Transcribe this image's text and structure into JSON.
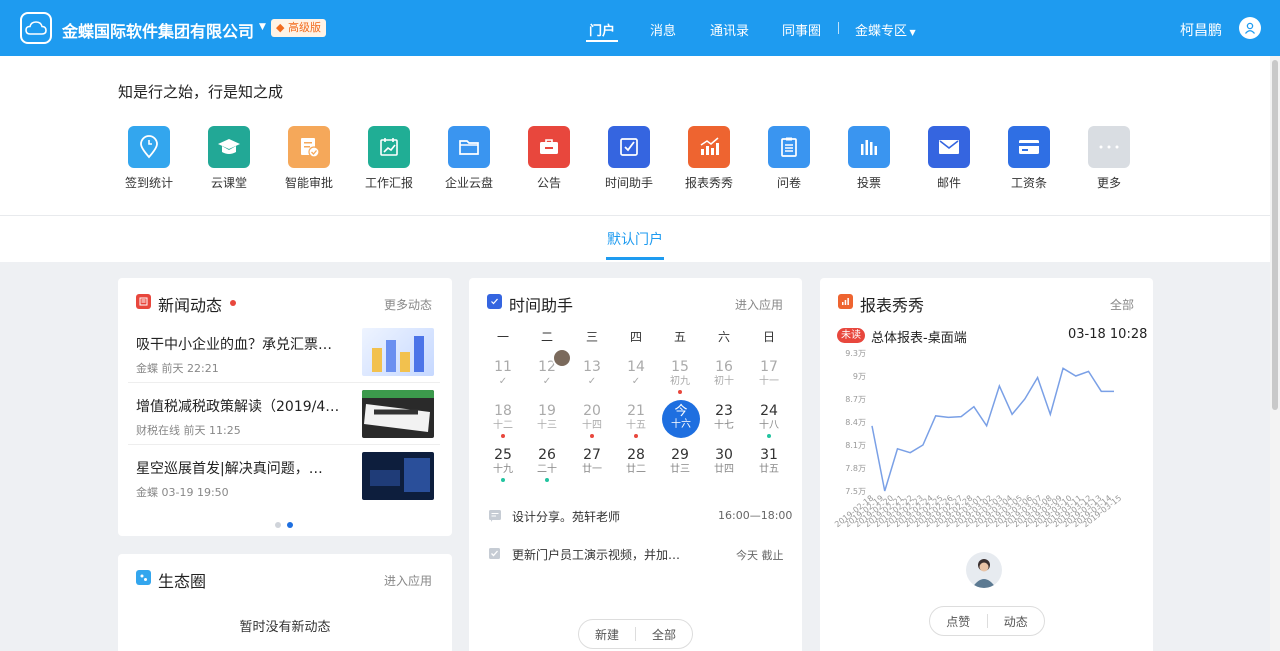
{
  "topbar": {
    "company": "金蝶国际软件集团有限公司",
    "badge": "高级版",
    "nav": [
      "门户",
      "消息",
      "通讯录",
      "同事圈",
      "金蝶专区"
    ],
    "user": "柯昌鹏"
  },
  "motto": "知是行之始，行是知之成",
  "apps": [
    {
      "label": "签到统计",
      "icon": "location-pin-icon",
      "color": "#33a6ee"
    },
    {
      "label": "云课堂",
      "icon": "graduation-cap-icon",
      "color": "#22a896"
    },
    {
      "label": "智能审批",
      "icon": "approval-icon",
      "color": "#f5a85a"
    },
    {
      "label": "工作汇报",
      "icon": "report-chart-icon",
      "color": "#20ae95"
    },
    {
      "label": "企业云盘",
      "icon": "folder-icon",
      "color": "#3a95f0"
    },
    {
      "label": "公告",
      "icon": "announcement-icon",
      "color": "#e8473d"
    },
    {
      "label": "时间助手",
      "icon": "checkbox-icon",
      "color": "#3565e0"
    },
    {
      "label": "报表秀秀",
      "icon": "bar-trend-icon",
      "color": "#ee6430"
    },
    {
      "label": "问卷",
      "icon": "clipboard-icon",
      "color": "#3a95f0"
    },
    {
      "label": "投票",
      "icon": "bars-icon",
      "color": "#3a95f0"
    },
    {
      "label": "邮件",
      "icon": "mail-icon",
      "color": "#3565e0"
    },
    {
      "label": "工资条",
      "icon": "card-icon",
      "color": "#2f6fe4"
    },
    {
      "label": "更多",
      "icon": "more-icon",
      "color": "#d9dde2"
    }
  ],
  "portal_tab": "默认门户",
  "news": {
    "title": "新闻动态",
    "more": "更多动态",
    "items": [
      {
        "title": "吸干中小企业的血？承兑汇票…",
        "meta": "金蝶 前天 22:21"
      },
      {
        "title": "增值税减税政策解读（2019/4…",
        "meta": "财税在线 前天 11:25"
      },
      {
        "title": "星空巡展首发|解决真问题，…",
        "meta": "金蝶 03-19 19:50"
      }
    ]
  },
  "eco": {
    "title": "生态圈",
    "link": "进入应用",
    "empty": "暂时没有新动态"
  },
  "time": {
    "title": "时间助手",
    "link": "进入应用",
    "weekdays": [
      "一",
      "二",
      "三",
      "四",
      "五",
      "六",
      "日"
    ],
    "rows": [
      [
        {
          "d": "11",
          "s": "✓",
          "past": true
        },
        {
          "d": "12",
          "s": "✓",
          "past": true
        },
        {
          "d": "13",
          "s": "✓",
          "past": true
        },
        {
          "d": "14",
          "s": "✓",
          "past": true
        },
        {
          "d": "15",
          "s": "初九",
          "past": true,
          "dot": "#e8473d"
        },
        {
          "d": "16",
          "s": "初十",
          "past": true
        },
        {
          "d": "17",
          "s": "十一",
          "past": true
        }
      ],
      [
        {
          "d": "18",
          "s": "十二",
          "past": true,
          "dot": "#e8473d"
        },
        {
          "d": "19",
          "s": "十三",
          "past": true
        },
        {
          "d": "20",
          "s": "十四",
          "past": true,
          "dot": "#e8473d"
        },
        {
          "d": "21",
          "s": "十五",
          "past": true,
          "dot": "#e8473d"
        },
        {
          "d": "今",
          "s": "十六",
          "today": true
        },
        {
          "d": "23",
          "s": "十七"
        },
        {
          "d": "24",
          "s": "十八",
          "dot": "#22c4a0"
        }
      ],
      [
        {
          "d": "25",
          "s": "十九",
          "dot": "#22c4a0"
        },
        {
          "d": "26",
          "s": "二十",
          "dot": "#22c4a0"
        },
        {
          "d": "27",
          "s": "廿一"
        },
        {
          "d": "28",
          "s": "廿二"
        },
        {
          "d": "29",
          "s": "廿三"
        },
        {
          "d": "30",
          "s": "廿四"
        },
        {
          "d": "31",
          "s": "廿五"
        }
      ]
    ],
    "tasks": [
      {
        "text": "设计分享。苑轩老师",
        "time": "16:00—18:00"
      },
      {
        "text": "更新门户员工演示视频，并加…",
        "time": "今天 截止"
      }
    ],
    "btn_new": "新建",
    "btn_all": "全部"
  },
  "report": {
    "title": "报表秀秀",
    "link": "全部",
    "tag": "未读",
    "name": "总体报表-桌面端",
    "datetime": "03-18 10:28",
    "btn_like": "点赞",
    "btn_feed": "动态",
    "chart_data": {
      "type": "line",
      "yticks": [
        "9.3万",
        "9万",
        "8.7万",
        "8.4万",
        "8.1万",
        "7.8万",
        "7.5万"
      ],
      "ylim": [
        74000,
        93000
      ],
      "x": [
        "2019-02-18",
        "2019-02-19",
        "2019-02-20",
        "2019-02-21",
        "2019-02-22",
        "2019-02-23",
        "2019-02-24",
        "2019-02-25",
        "2019-02-26",
        "2019-02-27",
        "2019-02-28",
        "2019-03-01",
        "2019-03-02",
        "2019-03-03",
        "2019-03-04",
        "2019-03-05",
        "2019-03-06",
        "2019-03-07",
        "2019-03-08",
        "2019-03-09",
        "2019-03-10",
        "2019-03-11",
        "2019-03-12",
        "2019-03-13",
        "2019-03-14",
        "2019-03-15"
      ],
      "values": [
        83500,
        75000,
        80500,
        80000,
        81000,
        84800,
        84600,
        84700,
        86000,
        83500,
        88700,
        85000,
        87000,
        89800,
        85000,
        91000,
        90000,
        90600,
        88000,
        88000
      ],
      "color": "#7aa0e6"
    }
  }
}
